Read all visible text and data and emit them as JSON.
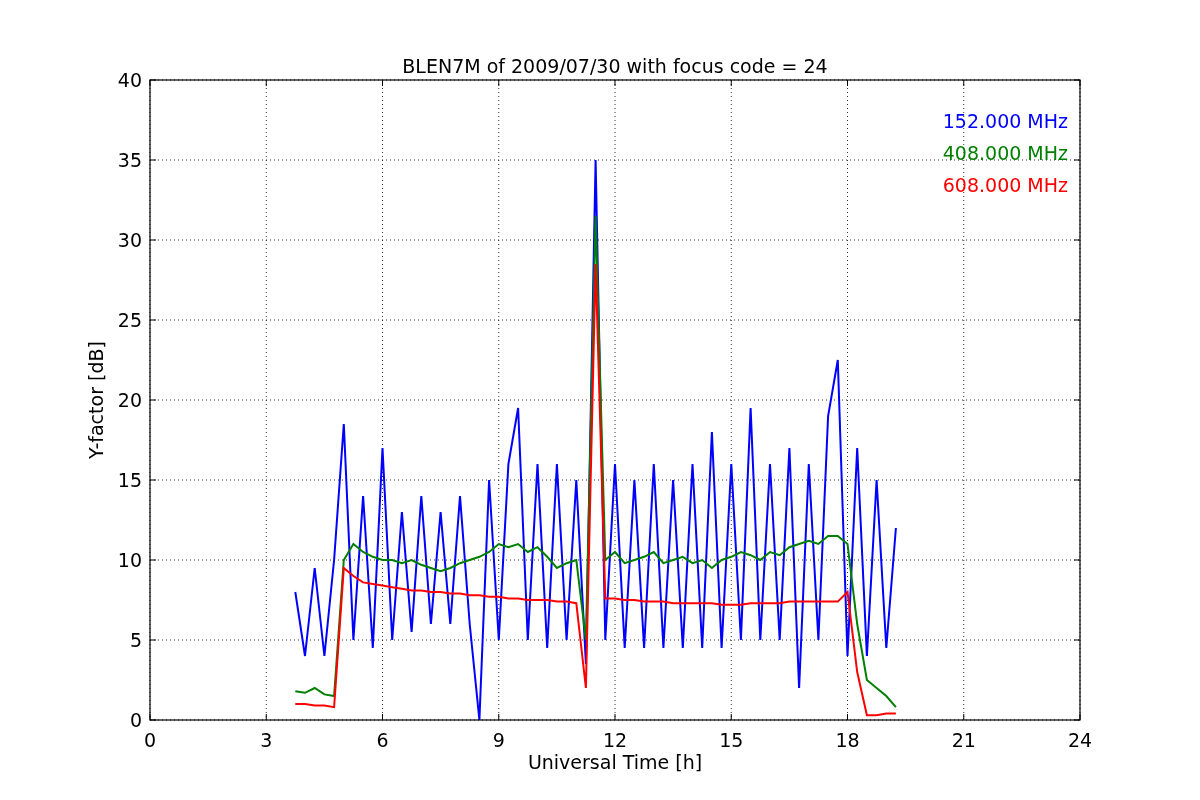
{
  "chart_data": {
    "type": "line",
    "title": "BLEN7M of 2009/07/30 with focus code = 24",
    "xlabel": "Universal Time [h]",
    "ylabel": "Y-factor [dB]",
    "x": [
      3.75,
      4,
      4.25,
      4.5,
      4.75,
      5,
      5.25,
      5.5,
      5.75,
      6,
      6.25,
      6.5,
      6.75,
      7,
      7.25,
      7.5,
      7.75,
      8,
      8.25,
      8.5,
      8.75,
      9,
      9.25,
      9.5,
      9.75,
      10,
      10.25,
      10.5,
      10.75,
      11,
      11.25,
      11.5,
      11.75,
      12,
      12.25,
      12.5,
      12.75,
      13,
      13.25,
      13.5,
      13.75,
      14,
      14.25,
      14.5,
      14.75,
      15,
      15.25,
      15.5,
      15.75,
      16,
      16.25,
      16.5,
      16.75,
      17,
      17.25,
      17.5,
      17.75,
      18,
      18.25,
      18.5,
      18.75,
      19,
      19.25
    ],
    "series": [
      {
        "name": "152.000 MHz",
        "color": "#0000ff",
        "values": [
          8,
          4,
          9.5,
          4,
          10,
          18.5,
          5,
          14,
          4.5,
          17,
          5,
          13,
          5.5,
          14,
          6,
          13,
          6,
          14,
          6,
          0,
          15,
          5,
          16,
          19.5,
          5,
          16,
          4.5,
          16,
          5,
          15,
          3.5,
          35,
          5,
          16,
          4.5,
          15,
          4.5,
          16,
          4.5,
          15,
          4.5,
          16,
          4.5,
          18,
          4.5,
          16,
          5,
          19.5,
          5,
          16,
          5,
          17,
          2,
          16,
          5,
          19,
          22.5,
          4,
          17,
          4,
          15,
          4.5,
          12
        ]
      },
      {
        "name": "408.000 MHz",
        "color": "#008000",
        "values": [
          1.8,
          1.7,
          2,
          1.6,
          1.5,
          10,
          11,
          10.5,
          10.2,
          10,
          10,
          9.8,
          10,
          9.7,
          9.5,
          9.3,
          9.5,
          9.8,
          10,
          10.2,
          10.5,
          11,
          10.8,
          11,
          10.5,
          10.8,
          10.2,
          9.5,
          9.8,
          10,
          5,
          31.5,
          10,
          10.5,
          9.8,
          10,
          10.2,
          10.5,
          9.8,
          10,
          10.2,
          9.8,
          10,
          9.5,
          10,
          10.2,
          10.5,
          10.3,
          10,
          10.5,
          10.3,
          10.8,
          11,
          11.2,
          11,
          11.5,
          11.5,
          11,
          6,
          2.5,
          2,
          1.5,
          0.8
        ]
      },
      {
        "name": "608.000 MHz",
        "color": "#ff0000",
        "values": [
          1,
          1,
          0.9,
          0.9,
          0.8,
          9.5,
          9,
          8.6,
          8.5,
          8.4,
          8.3,
          8.2,
          8.1,
          8.1,
          8,
          8,
          7.9,
          7.9,
          7.8,
          7.8,
          7.7,
          7.7,
          7.6,
          7.6,
          7.5,
          7.5,
          7.5,
          7.4,
          7.4,
          7.3,
          2,
          28.5,
          7.6,
          7.6,
          7.5,
          7.5,
          7.4,
          7.4,
          7.4,
          7.3,
          7.3,
          7.3,
          7.3,
          7.3,
          7.2,
          7.2,
          7.2,
          7.3,
          7.3,
          7.3,
          7.3,
          7.4,
          7.4,
          7.4,
          7.4,
          7.4,
          7.4,
          8,
          3,
          0.3,
          0.3,
          0.4,
          0.4
        ]
      }
    ],
    "xlim": [
      0,
      24
    ],
    "ylim": [
      0,
      40
    ],
    "xticks": [
      0,
      3,
      6,
      9,
      12,
      15,
      18,
      21,
      24
    ],
    "yticks": [
      0,
      5,
      10,
      15,
      20,
      25,
      30,
      35,
      40
    ],
    "grid": true
  }
}
